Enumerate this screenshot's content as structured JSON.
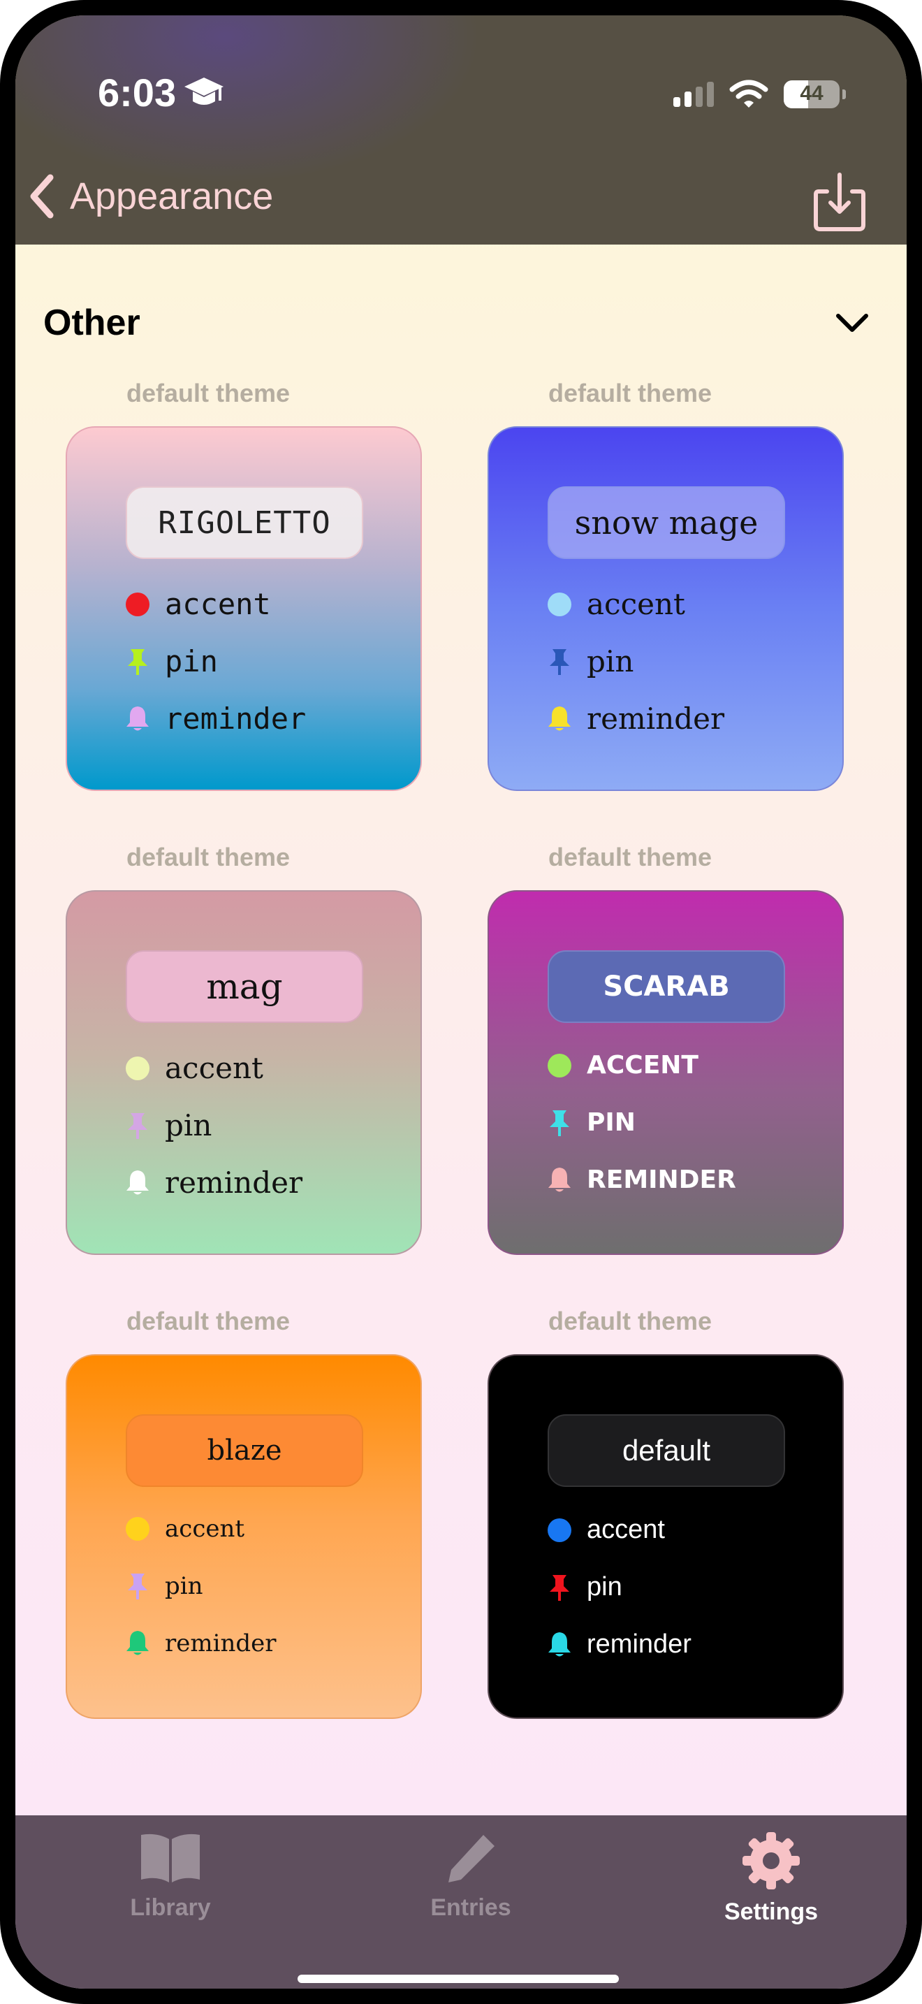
{
  "status_bar": {
    "time": "6:03",
    "battery": "44"
  },
  "nav": {
    "back_label": "Appearance"
  },
  "section": {
    "title": "Other"
  },
  "themes": [
    {
      "caption": "default theme",
      "name": "RIGOLETTO",
      "accent_label": "accent",
      "pin_label": "pin",
      "reminder_label": "reminder",
      "colors": {
        "accent": "#ee1c24",
        "pin": "#b6f01e",
        "reminder": "#e2a8f0"
      }
    },
    {
      "caption": "default theme",
      "name": "snow mage",
      "accent_label": "accent",
      "pin_label": "pin",
      "reminder_label": "reminder",
      "colors": {
        "accent": "#9fdcf8",
        "pin": "#2a57b8",
        "reminder": "#f7e12c"
      }
    },
    {
      "caption": "default theme",
      "name": "mag",
      "accent_label": "accent",
      "pin_label": "pin",
      "reminder_label": "reminder",
      "colors": {
        "accent": "#eef5b0",
        "pin": "#d4a6e4",
        "reminder": "#ffffff"
      }
    },
    {
      "caption": "default theme",
      "name": "SCARAB",
      "accent_label": "ACCENT",
      "pin_label": "PIN",
      "reminder_label": "REMINDER",
      "colors": {
        "accent": "#9ee85a",
        "pin": "#3ee0e8",
        "reminder": "#f7b2b4"
      }
    },
    {
      "caption": "default theme",
      "name": "blaze",
      "accent_label": "accent",
      "pin_label": "pin",
      "reminder_label": "reminder",
      "colors": {
        "accent": "#ffd21c",
        "pin": "#c9a2f2",
        "reminder": "#1ec87a"
      }
    },
    {
      "caption": "default theme",
      "name": "default",
      "accent_label": "accent",
      "pin_label": "pin",
      "reminder_label": "reminder",
      "colors": {
        "accent": "#1877f2",
        "pin": "#f0141e",
        "reminder": "#2ad8e6"
      }
    }
  ],
  "tabs": [
    {
      "label": "Library",
      "icon": "book-icon"
    },
    {
      "label": "Entries",
      "icon": "pencil-icon"
    },
    {
      "label": "Settings",
      "icon": "gear-icon",
      "selected": true
    }
  ]
}
